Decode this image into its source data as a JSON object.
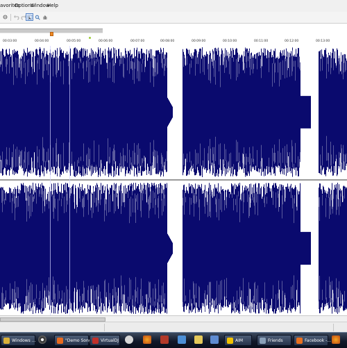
{
  "menubar": {
    "items": [
      {
        "label": "avorites"
      },
      {
        "label": "Options"
      },
      {
        "label": "Window"
      },
      {
        "label": "Help"
      }
    ]
  },
  "toolbar": {
    "buttons": [
      {
        "name": "zoom-out-icon"
      },
      {
        "name": "undo-icon"
      },
      {
        "name": "redo-icon"
      },
      {
        "name": "selection-tool-icon",
        "active": true
      },
      {
        "name": "zoom-tool-icon"
      },
      {
        "name": "hand-tool-icon"
      },
      {
        "name": "marker-icon"
      },
      {
        "name": "scrub-icon"
      }
    ]
  },
  "ruler": {
    "labels": [
      "00:03:00",
      "00:04:00",
      "00:05:00",
      "00:06:00",
      "00:07:00",
      "00:08:00",
      "00:09:00",
      "00:10:00",
      "00:11:00",
      "00:12:00",
      "00:13:00"
    ]
  },
  "waveform": {
    "color": "#0a0a6e",
    "background": "#ffffff",
    "channels": 2
  },
  "taskbar": {
    "items": [
      {
        "label": "Windows ...",
        "icon": "windows-explorer-icon",
        "color": "#d9b13a"
      },
      {
        "label": "\"Demo Song\"",
        "icon": "audio-editor-icon",
        "color": "#e86a1e"
      },
      {
        "label": "VirtualDJ",
        "icon": "virtualdj-icon",
        "color": "#c0302a"
      },
      {
        "label": "AIM",
        "icon": "aim-icon",
        "color": "#f2c200"
      },
      {
        "label": "Friends",
        "icon": "folder-icon",
        "color": "#8aa0b8"
      },
      {
        "label": "Facebook -...",
        "icon": "firefox-icon",
        "color": "#e8701f"
      }
    ]
  }
}
